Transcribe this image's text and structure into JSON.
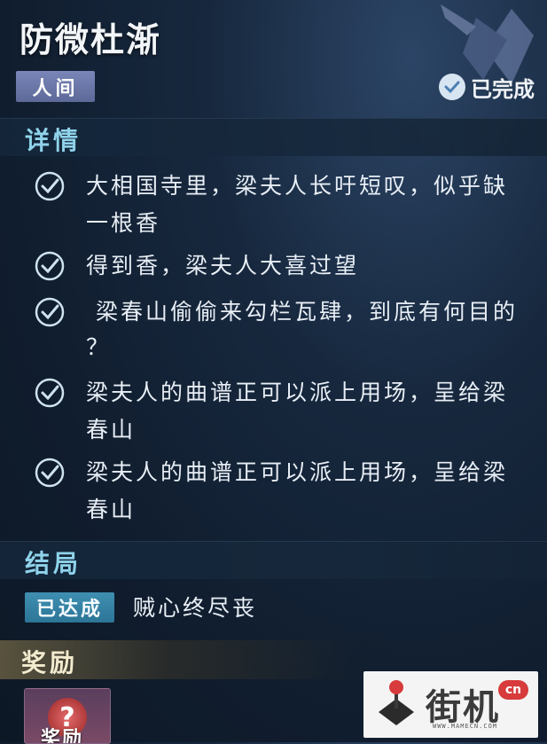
{
  "quest": {
    "title": "防微杜渐",
    "category": "人间",
    "status": "已完成"
  },
  "details": {
    "heading": "详情",
    "tasks": [
      {
        "lines": [
          "大相国寺里，梁夫人长吁短叹，似乎缺",
          "一根香"
        ],
        "done": true
      },
      {
        "lines": [
          "得到香，梁夫人大喜过望"
        ],
        "done": true
      },
      {
        "lines": [
          " 梁春山偷偷来勾栏瓦肆，到底有何目的",
          "？"
        ],
        "done": true
      },
      {
        "lines": [
          "梁夫人的曲谱正可以派上用场，呈给梁",
          "春山"
        ],
        "done": true
      },
      {
        "lines": [
          "梁夫人的曲谱正可以派上用场，呈给梁",
          "春山"
        ],
        "done": true
      }
    ]
  },
  "ending": {
    "heading": "结局",
    "achieved_label": "已达成",
    "text": "贼心终尽丧"
  },
  "reward": {
    "heading": "奖励",
    "item_label": "奖励",
    "item_icon": "?"
  },
  "watermark": {
    "brand": "街机",
    "badge": "cn",
    "url": "WWW.MAMECN.COM"
  },
  "colors": {
    "accent": "#8fd3ea",
    "category_tag": "#6a76a8",
    "achieved_tag": "#3a88ab"
  }
}
